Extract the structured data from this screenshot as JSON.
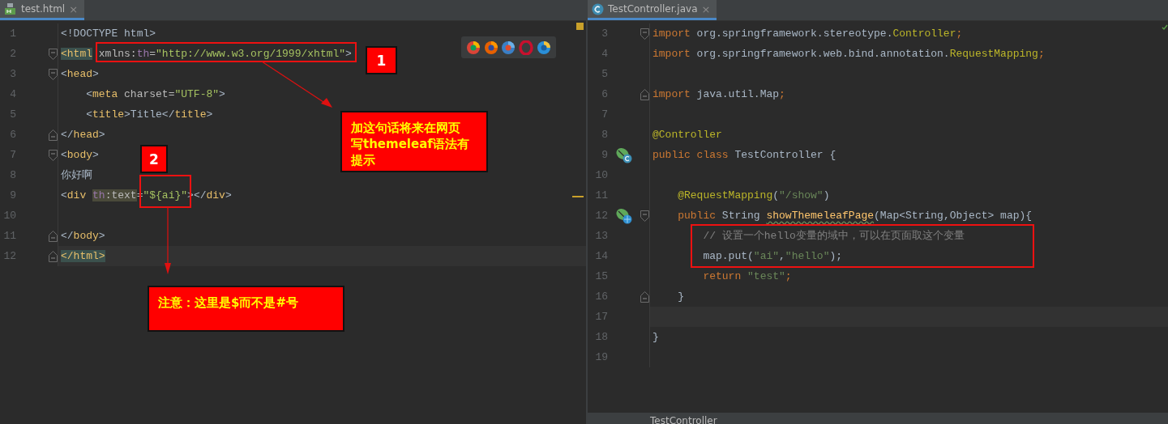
{
  "editors": [
    {
      "tab": {
        "title": "test.html",
        "close": "×",
        "selected": true
      },
      "browser_bar": true,
      "lines": [
        {
          "number": "1",
          "tokens": [
            {
              "kind": "punct",
              "text": "<"
            },
            {
              "kind": "text",
              "text": "!DOCTYPE html"
            },
            {
              "kind": "punct",
              "text": ">"
            }
          ]
        },
        {
          "number": "2",
          "fold_open": true,
          "tokens": [
            {
              "kind": "tag_match",
              "text": "<html"
            },
            {
              "kind": "attr",
              "text": " xmlns:"
            },
            {
              "kind": "ns",
              "text": "th"
            },
            {
              "kind": "attr",
              "text": "="
            },
            {
              "kind": "str",
              "text": "\"http://www.w3.org/1999/xhtml\""
            },
            {
              "kind": "punct",
              "text": ">"
            }
          ]
        },
        {
          "number": "3",
          "fold_open": true,
          "tokens": [
            {
              "kind": "punct",
              "text": "<"
            },
            {
              "kind": "tag",
              "text": "head"
            },
            {
              "kind": "punct",
              "text": ">"
            }
          ]
        },
        {
          "number": "4",
          "tokens": [
            {
              "kind": "punct",
              "text": "    <"
            },
            {
              "kind": "tag",
              "text": "meta"
            },
            {
              "kind": "attr",
              "text": " charset="
            },
            {
              "kind": "str",
              "text": "\"UTF-8\""
            },
            {
              "kind": "punct",
              "text": ">"
            }
          ]
        },
        {
          "number": "5",
          "tokens": [
            {
              "kind": "punct",
              "text": "    <"
            },
            {
              "kind": "tag",
              "text": "title"
            },
            {
              "kind": "punct",
              "text": ">"
            },
            {
              "kind": "text",
              "text": "Title"
            },
            {
              "kind": "punct",
              "text": "</"
            },
            {
              "kind": "tag",
              "text": "title"
            },
            {
              "kind": "punct",
              "text": ">"
            }
          ]
        },
        {
          "number": "6",
          "fold_close": true,
          "tokens": [
            {
              "kind": "punct",
              "text": "</"
            },
            {
              "kind": "tag",
              "text": "head"
            },
            {
              "kind": "punct",
              "text": ">"
            }
          ]
        },
        {
          "number": "7",
          "fold_open": true,
          "tokens": [
            {
              "kind": "punct",
              "text": "<"
            },
            {
              "kind": "tag",
              "text": "body"
            },
            {
              "kind": "punct",
              "text": ">"
            }
          ]
        },
        {
          "number": "8",
          "tokens": [
            {
              "kind": "text",
              "text": "你好啊"
            }
          ]
        },
        {
          "number": "9",
          "tokens": [
            {
              "kind": "punct",
              "text": "<"
            },
            {
              "kind": "tag",
              "text": "div "
            },
            {
              "kind": "ns_hl",
              "text": "th"
            },
            {
              "kind": "attr_hl",
              "text": ":text"
            },
            {
              "kind": "attr",
              "text": "="
            },
            {
              "kind": "str",
              "text": "\"${ai}\""
            },
            {
              "kind": "punct",
              "text": "></"
            },
            {
              "kind": "tag",
              "text": "div"
            },
            {
              "kind": "punct",
              "text": ">"
            }
          ]
        },
        {
          "number": "10"
        },
        {
          "number": "11",
          "fold_close": true,
          "tokens": [
            {
              "kind": "punct",
              "text": "</"
            },
            {
              "kind": "tag",
              "text": "body"
            },
            {
              "kind": "punct",
              "text": ">"
            }
          ]
        },
        {
          "number": "12",
          "fold_close": true,
          "current": true,
          "tokens": [
            {
              "kind": "tag_match",
              "text": "</html>"
            }
          ]
        }
      ]
    },
    {
      "tab": {
        "title": "TestController.java",
        "close": "×",
        "selected": true
      },
      "breadcrumb": "TestController",
      "lines": [
        {
          "number": "3",
          "fold_open": true,
          "tokens": [
            {
              "kind": "kw",
              "text": "import"
            },
            {
              "kind": "text",
              "text": " org.springframework.stereotype."
            },
            {
              "kind": "cls",
              "text": "Controller"
            },
            {
              "kind": "kw",
              "text": ";"
            }
          ]
        },
        {
          "number": "4",
          "tokens": [
            {
              "kind": "kw",
              "text": "import"
            },
            {
              "kind": "text",
              "text": " org.springframework.web.bind.annotation."
            },
            {
              "kind": "cls",
              "text": "RequestMapping"
            },
            {
              "kind": "kw",
              "text": ";"
            }
          ]
        },
        {
          "number": "5"
        },
        {
          "number": "6",
          "fold_close": true,
          "tokens": [
            {
              "kind": "kw",
              "text": "import"
            },
            {
              "kind": "text",
              "text": " java.util.Map"
            },
            {
              "kind": "kw",
              "text": ";"
            }
          ]
        },
        {
          "number": "7"
        },
        {
          "number": "8",
          "tokens": [
            {
              "kind": "ann",
              "text": "@Controller"
            }
          ]
        },
        {
          "number": "9",
          "bean": true,
          "tokens": [
            {
              "kind": "kw",
              "text": "public class "
            },
            {
              "kind": "text",
              "text": "TestController {"
            }
          ]
        },
        {
          "number": "10"
        },
        {
          "number": "11",
          "tokens": [
            {
              "kind": "ann",
              "text": "    @RequestMapping"
            },
            {
              "kind": "text",
              "text": "("
            },
            {
              "kind": "jstr",
              "text": "\"/show\""
            },
            {
              "kind": "text",
              "text": ")"
            }
          ]
        },
        {
          "number": "12",
          "fold_open": true,
          "bean": true,
          "web": true,
          "tokens": [
            {
              "kind": "kw",
              "text": "    public "
            },
            {
              "kind": "text",
              "text": "String "
            },
            {
              "kind": "method_typo",
              "text": "showThemeleafPage"
            },
            {
              "kind": "text",
              "text": "(Map<String,Object> map){"
            }
          ]
        },
        {
          "number": "13",
          "tokens": [
            {
              "kind": "comment",
              "text": "        // 设置一个hello变量的域中，可以在页面取这个变量"
            }
          ]
        },
        {
          "number": "14",
          "tokens": [
            {
              "kind": "text",
              "text": "        map.put("
            },
            {
              "kind": "jstr",
              "text": "\"ai\""
            },
            {
              "kind": "text",
              "text": ","
            },
            {
              "kind": "jstr",
              "text": "\"hello\""
            },
            {
              "kind": "text",
              "text": ");"
            }
          ]
        },
        {
          "number": "15",
          "tokens": [
            {
              "kind": "kw",
              "text": "        return "
            },
            {
              "kind": "jstr",
              "text": "\"test\""
            },
            {
              "kind": "kw",
              "text": ";"
            }
          ]
        },
        {
          "number": "16",
          "fold_close": true,
          "tokens": [
            {
              "kind": "text",
              "text": "    }"
            }
          ]
        },
        {
          "number": "17",
          "current": true
        },
        {
          "number": "18",
          "tokens": [
            {
              "kind": "text",
              "text": "}"
            }
          ]
        },
        {
          "number": "19"
        }
      ]
    }
  ],
  "callouts": [
    {
      "kind": "number",
      "text": "1"
    },
    {
      "kind": "number",
      "text": "2"
    },
    {
      "kind": "note",
      "text": "加这句话将来在网页写themeleaf语法有提示"
    },
    {
      "kind": "note",
      "text": "注意：这里是$而不是#号"
    }
  ]
}
